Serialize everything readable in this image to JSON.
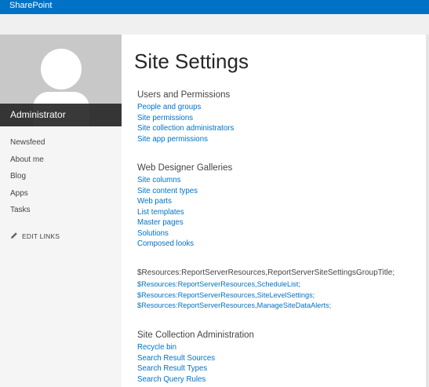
{
  "suite_bar": {
    "brand": "SharePoint",
    "color": "#0072c6"
  },
  "profile": {
    "name": "Administrator"
  },
  "quick_launch": {
    "items": [
      "Newsfeed",
      "About me",
      "Blog",
      "Apps",
      "Tasks"
    ],
    "edit_links": "EDIT LINKS"
  },
  "page": {
    "title": "Site Settings"
  },
  "sections": {
    "users": {
      "heading": "Users and Permissions",
      "links": [
        "People and groups",
        "Site permissions",
        "Site collection administrators",
        "Site app permissions"
      ]
    },
    "galleries": {
      "heading": "Web Designer Galleries",
      "links": [
        "Site columns",
        "Site content types",
        "Web parts",
        "List templates",
        "Master pages",
        "Solutions",
        "Composed looks"
      ]
    },
    "report": {
      "heading": "$Resources:ReportServerResources,ReportServerSiteSettingsGroupTitle;",
      "links": [
        "$Resources:ReportServerResources,ScheduleList;",
        "$Resources:ReportServerResources,SiteLevelSettings;",
        "$Resources:ReportServerResources,ManageSiteDataAlerts;"
      ]
    },
    "collection": {
      "heading": "Site Collection Administration",
      "links": [
        "Recycle bin",
        "Search Result Sources",
        "Search Result Types",
        "Search Query Rules"
      ]
    }
  },
  "colors": {
    "link": "#0072c6",
    "accent": "#0072c6"
  }
}
